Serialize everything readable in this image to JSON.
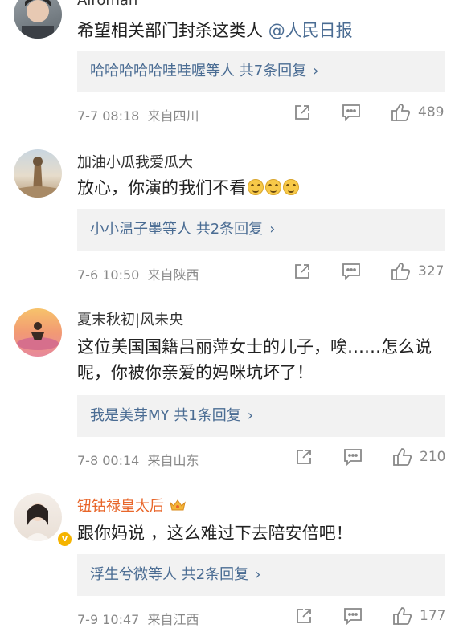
{
  "comments": [
    {
      "username": "Airoman",
      "text": "希望相关部门封杀这类人 ",
      "mention": "@人民日报",
      "replies_users": "哈哈哈哈哈哇哇喔等人",
      "replies_count": "共7条回复",
      "time": "7-7 08:18",
      "location": "来自四川",
      "likes": "489"
    },
    {
      "username": "加油小瓜我爱瓜大",
      "text": "放心，你演的我们不看",
      "replies_users": "小小温子墨等人",
      "replies_count": "共2条回复",
      "time": "7-6 10:50",
      "location": "来自陕西",
      "likes": "327"
    },
    {
      "username": "夏末秋初|风未央",
      "text": "这位美国国籍吕丽萍女士的儿子，唉……怎么说呢，你被你亲爱的妈咪坑坏了！",
      "replies_users": "我是美芽MY",
      "replies_count": "共1条回复",
      "time": "7-8 00:14",
      "location": "来自山东",
      "likes": "210"
    },
    {
      "username": "钮钴禄皇太后",
      "text": "跟你妈说 ，这么难过下去陪安倍吧！",
      "replies_users": "浮生兮微等人",
      "replies_count": "共2条回复",
      "time": "7-9 10:47",
      "location": "来自江西",
      "likes": "177"
    }
  ],
  "colors": {
    "link": "#4a6c93",
    "vip_name": "#e8662a",
    "meta": "#888888",
    "reply_bg": "#f2f2f2"
  },
  "icons": [
    "share-icon",
    "comment-icon",
    "like-icon",
    "smile-emoji",
    "crown-icon",
    "verified-badge"
  ]
}
